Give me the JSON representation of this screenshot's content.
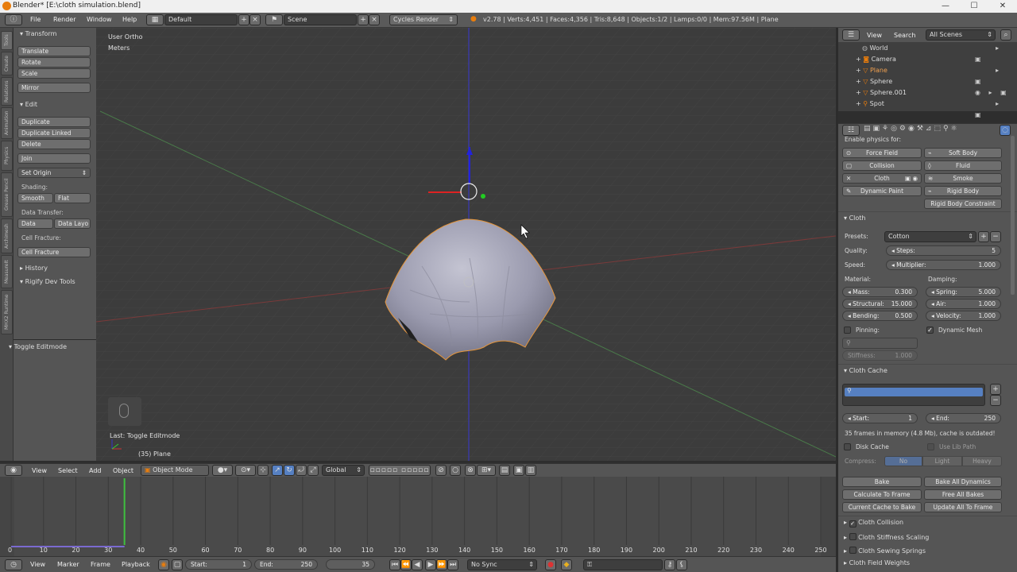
{
  "window": {
    "title": "Blender* [E:\\cloth simulation.blend]",
    "minimize": "—",
    "maximize": "☐",
    "close": "✕"
  },
  "menubar": {
    "menus": [
      "File",
      "Render",
      "Window",
      "Help"
    ],
    "layout": "Default",
    "scene": "Scene",
    "engine": "Cycles Render",
    "stats": "v2.78 | Verts:4,451 | Faces:4,356 | Tris:8,648 | Objects:1/2 | Lamps:0/0 | Mem:97.56M | Plane"
  },
  "tool_tabs": [
    "Tools",
    "Create",
    "Relations",
    "Animation",
    "Physics",
    "Grease Pencil",
    "Archimesh",
    "MeasureIt",
    "MHX2 Runtime"
  ],
  "tool_shelf": {
    "transform_header": "Transform",
    "translate": "Translate",
    "rotate": "Rotate",
    "scale": "Scale",
    "mirror": "Mirror",
    "edit_header": "Edit",
    "duplicate": "Duplicate",
    "duplicate_linked": "Duplicate Linked",
    "delete": "Delete",
    "join": "Join",
    "set_origin": "Set Origin",
    "shading_label": "Shading:",
    "smooth": "Smooth",
    "flat": "Flat",
    "data_transfer_label": "Data Transfer:",
    "data": "Data",
    "data_layout": "Data Layo",
    "cell_fracture_label": "Cell Fracture:",
    "cell_fracture": "Cell Fracture",
    "history": "History",
    "rigify": "Rigify Dev Tools",
    "toggle_editmode": "Toggle Editmode"
  },
  "viewport": {
    "view_name": "User Ortho",
    "units": "Meters",
    "last_op": "Last: Toggle Editmode",
    "frame_object": "(35) Plane"
  },
  "view3d_header": {
    "menus": [
      "View",
      "Select",
      "Add",
      "Object"
    ],
    "mode": "Object Mode",
    "orientation": "Global"
  },
  "timeline": {
    "ticks": [
      "0",
      "10",
      "20",
      "30",
      "40",
      "50",
      "60",
      "70",
      "80",
      "90",
      "100",
      "110",
      "120",
      "130",
      "140",
      "150",
      "160",
      "170",
      "180",
      "190",
      "200",
      "210",
      "220",
      "230",
      "240",
      "250"
    ],
    "current_frame": 35
  },
  "timeline_header": {
    "menus": [
      "View",
      "Marker",
      "Frame",
      "Playback"
    ],
    "start_label": "Start:",
    "start": "1",
    "end_label": "End:",
    "end": "250",
    "current": "35",
    "sync": "No Sync"
  },
  "outliner": {
    "view": "View",
    "search": "Search",
    "scenes": "All Scenes",
    "items": [
      "World",
      "Camera",
      "Plane",
      "Sphere",
      "Sphere.001",
      "Spot"
    ]
  },
  "physics": {
    "enable_label": "Enable physics for:",
    "force_field": "Force Field",
    "soft_body": "Soft Body",
    "collision": "Collision",
    "fluid": "Fluid",
    "cloth": "Cloth",
    "smoke": "Smoke",
    "dynamic_paint": "Dynamic Paint",
    "rigid_body": "Rigid Body",
    "rigid_body_constraint": "Rigid Body Constraint",
    "cloth_header": "Cloth",
    "presets_label": "Presets:",
    "preset": "Cotton",
    "quality_label": "Quality:",
    "steps_label": "Steps:",
    "steps": "5",
    "speed_label": "Speed:",
    "multiplier_label": "Multiplier:",
    "multiplier": "1.000",
    "material_label": "Material:",
    "damping_label": "Damping:",
    "mass_label": "Mass:",
    "mass": "0.300",
    "spring_label": "Spring:",
    "spring": "5.000",
    "structural_label": "Structural:",
    "structural": "15.000",
    "air_label": "Air:",
    "air": "1.000",
    "bending_label": "Bending:",
    "bending": "0.500",
    "velocity_label": "Velocity:",
    "velocity": "1.000",
    "pinning": "Pinning:",
    "dynamic_mesh": "Dynamic Mesh",
    "stiffness_label": "Stiffness:",
    "stiffness": "1.000",
    "cache_header": "Cloth Cache",
    "cache_start_label": "Start:",
    "cache_start": "1",
    "cache_end_label": "End:",
    "cache_end": "250",
    "cache_status": "35 frames in memory (4.8 Mb), cache is outdated!",
    "disk_cache": "Disk Cache",
    "use_lib_path": "Use Lib Path",
    "compress_label": "Compress:",
    "compress_no": "No",
    "compress_light": "Light",
    "compress_heavy": "Heavy",
    "bake": "Bake",
    "bake_all": "Bake All Dynamics",
    "calc_to_frame": "Calculate To Frame",
    "free_all": "Free All Bakes",
    "current_to_bake": "Current Cache to Bake",
    "update_all": "Update All To Frame",
    "sub_collision": "Cloth Collision",
    "sub_stiffness": "Cloth Stiffness Scaling",
    "sub_sewing": "Cloth Sewing Springs",
    "sub_field": "Cloth Field Weights"
  },
  "colors": {
    "accent": "#5680c2",
    "selection": "#f0a050",
    "timeline_cursor": "#3fbf3f"
  }
}
